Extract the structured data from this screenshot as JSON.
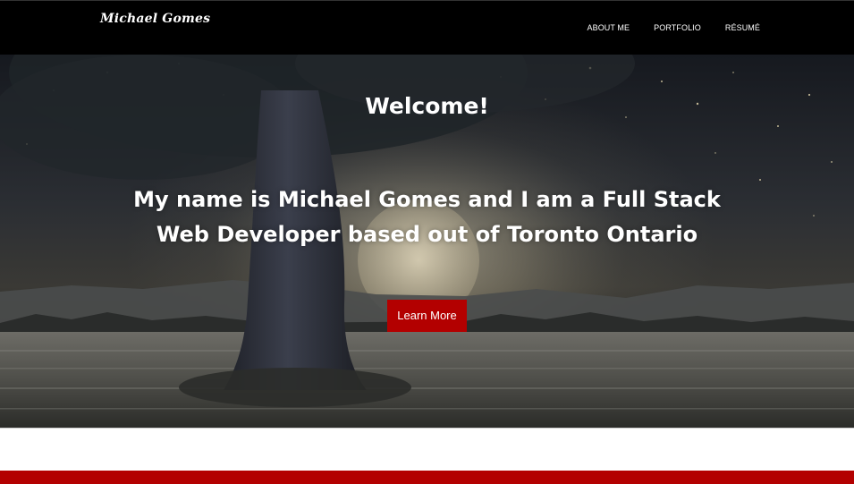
{
  "navbar": {
    "brand": "Michael Gomes",
    "links": [
      {
        "label": "ABOUT ME"
      },
      {
        "label": "PORTFOLIO"
      },
      {
        "label": "RÉSUMÉ"
      }
    ]
  },
  "hero": {
    "title": "Welcome!",
    "subtitle": "My name is Michael Gomes and I am a Full Stack Web Developer based out of Toronto Ontario",
    "button_label": "Learn More",
    "background_image": "night-moon-tree-landscape"
  },
  "colors": {
    "navbar_bg": "#000000",
    "accent": "#b30000",
    "text": "#ffffff"
  }
}
